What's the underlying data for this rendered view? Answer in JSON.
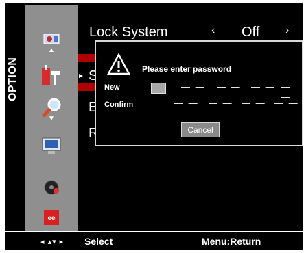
{
  "side_title": "OPTION",
  "menu": {
    "lock_system": {
      "label": "Lock System",
      "value": "Off",
      "left_arrow": "‹",
      "right_arrow": "›"
    },
    "partial_letters": [
      "S",
      "E",
      "R"
    ]
  },
  "dialog": {
    "title": "Please enter password",
    "new_label": "New",
    "confirm_label": "Confirm",
    "dash_group": "— —",
    "cancel": "Cancel"
  },
  "footer": {
    "nav_glyphs": "◂ ▴▾ ▸",
    "select": "Select",
    "return": "Menu:Return"
  },
  "icons": [
    "tools-icon",
    "lock-tools-icon",
    "magnifier-icon",
    "monitor-icon",
    "disc-icon",
    "ee-logo-icon"
  ],
  "colors": {
    "highlight": "#b10000",
    "icon_column": "#8f8f8f"
  }
}
